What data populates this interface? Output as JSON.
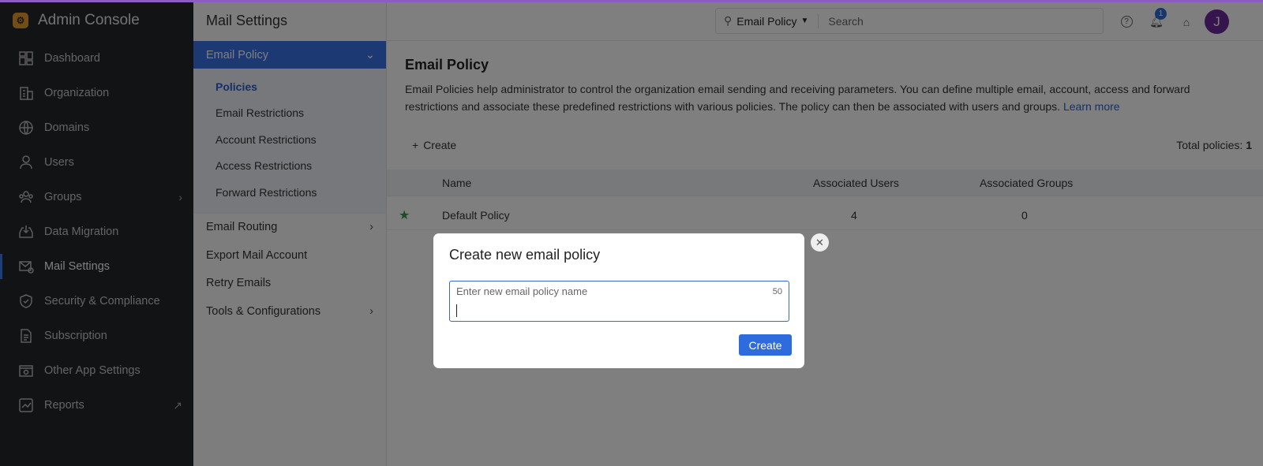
{
  "app": {
    "title": "Admin Console"
  },
  "sidebar": {
    "items": [
      {
        "label": "Dashboard",
        "icon": "dashboard-icon"
      },
      {
        "label": "Organization",
        "icon": "building-icon"
      },
      {
        "label": "Domains",
        "icon": "globe-icon"
      },
      {
        "label": "Users",
        "icon": "user-icon"
      },
      {
        "label": "Groups",
        "icon": "groups-icon",
        "trail": "›"
      },
      {
        "label": "Data Migration",
        "icon": "inbox-download-icon"
      },
      {
        "label": "Mail Settings",
        "icon": "mail-settings-icon",
        "active": true
      },
      {
        "label": "Security & Compliance",
        "icon": "shield-icon"
      },
      {
        "label": "Subscription",
        "icon": "document-icon"
      },
      {
        "label": "Other App Settings",
        "icon": "app-settings-icon"
      },
      {
        "label": "Reports",
        "icon": "chart-icon",
        "trail": "↗"
      }
    ]
  },
  "subnav": {
    "title": "Mail Settings",
    "active": "Email Policy",
    "children": [
      "Policies",
      "Email Restrictions",
      "Account Restrictions",
      "Access Restrictions",
      "Forward Restrictions"
    ],
    "items": [
      {
        "label": "Email Routing",
        "chevron": true
      },
      {
        "label": "Export Mail Account"
      },
      {
        "label": "Retry Emails"
      },
      {
        "label": "Tools & Configurations",
        "chevron": true
      }
    ]
  },
  "header": {
    "search_scope": "Email Policy",
    "search_placeholder": "Search",
    "notification_count": "1",
    "avatar_initial": "J"
  },
  "main": {
    "title": "Email Policy",
    "description": "Email Policies help administrator to control the organization email sending and receiving parameters. You can define multiple email, account, access and forward restrictions and associate these predefined restrictions with various policies. The policy can then be associated with users and groups.",
    "learn_more": "Learn more",
    "create_label": "Create",
    "total_label": "Total policies:",
    "total_value": "1",
    "columns": [
      "Name",
      "Associated Users",
      "Associated Groups"
    ],
    "rows": [
      {
        "name": "Default Policy",
        "users": "4",
        "groups": "0",
        "default": true
      }
    ]
  },
  "modal": {
    "title": "Create new email policy",
    "field_label": "Enter new email policy name",
    "field_value": "",
    "char_limit": "50",
    "create_button": "Create"
  },
  "colors": {
    "accent": "#3872e6",
    "brand_line": "#8a5cc4",
    "avatar": "#6d2a9e",
    "default_star": "#3a9a4a"
  }
}
